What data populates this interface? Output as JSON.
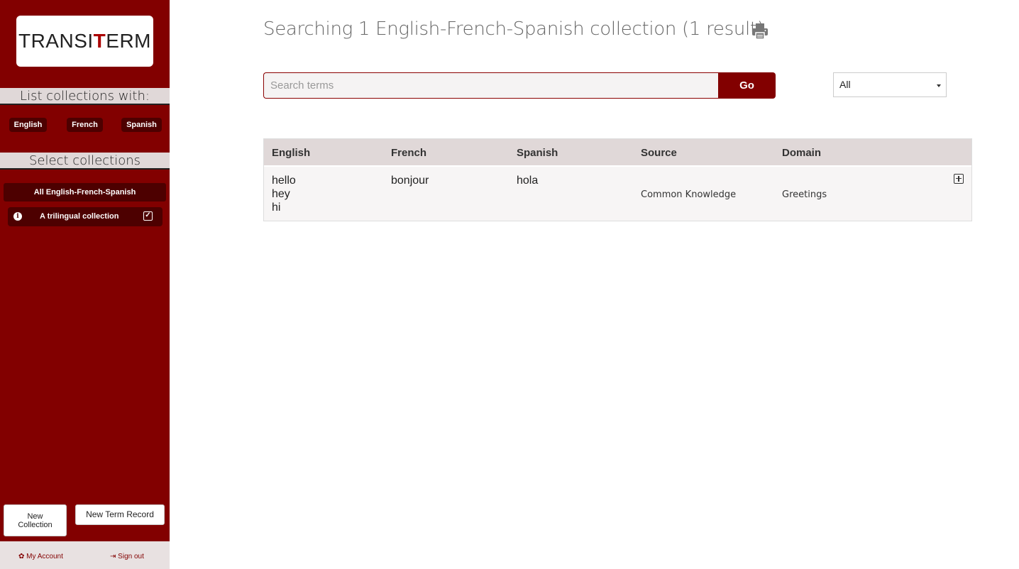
{
  "brand": {
    "logo_text_before": "TRANSI",
    "logo_text_mark": "T",
    "logo_text_after": "ERM"
  },
  "sidebar": {
    "list_heading": "List collections with:",
    "languages": [
      "English",
      "French",
      "Spanish"
    ],
    "select_heading": "Select collections",
    "all_collections": "All English-French-Spanish",
    "collections": [
      {
        "label": "A trilingual collection",
        "checked": true
      }
    ],
    "new_collection": "New Collection",
    "new_collection_line1": "New",
    "new_collection_line2": "Collection",
    "new_term_record": "New Term Record",
    "my_account": "My Account",
    "sign_out": "Sign out"
  },
  "main": {
    "heading": "Searching 1 English-French-Spanish collection (1 result)",
    "search": {
      "placeholder": "Search terms",
      "value": "",
      "go_label": "Go"
    },
    "filter": {
      "selected": "All"
    },
    "table": {
      "headers": [
        "English",
        "French",
        "Spanish",
        "Source",
        "Domain"
      ],
      "rows": [
        {
          "english": [
            "hello",
            "hey",
            "hi"
          ],
          "french": [
            "bonjour"
          ],
          "spanish": [
            "hola"
          ],
          "source": "Common Knowledge",
          "domain": "Greetings"
        }
      ]
    }
  },
  "colors": {
    "brand": "#820000",
    "brand_dark": "#4d0000",
    "header_bg": "#e0d8d8"
  },
  "icons": [
    "print-icon",
    "info-icon",
    "check-square-icon",
    "expand-plus-icon",
    "gear-icon",
    "sign-out-icon"
  ]
}
